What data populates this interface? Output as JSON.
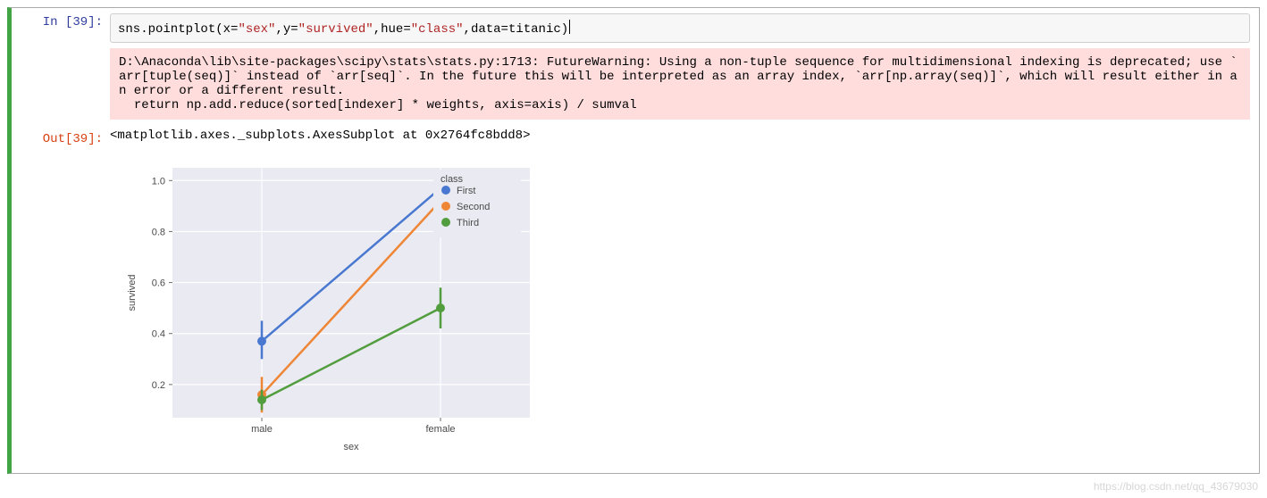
{
  "cell": {
    "in_prompt": "In [39]:",
    "out_prompt": "Out[39]:",
    "code_tokens": {
      "fn": "sns.pointplot",
      "arg1k": "x",
      "arg1v": "\"sex\"",
      "arg2k": "y",
      "arg2v": "\"survived\"",
      "arg3k": "hue",
      "arg3v": "\"class\"",
      "arg4k": "data",
      "arg4v": "titanic"
    },
    "stderr": "D:\\Anaconda\\lib\\site-packages\\scipy\\stats\\stats.py:1713: FutureWarning: Using a non-tuple sequence for multidimensional indexing is deprecated; use `arr[tuple(seq)]` instead of `arr[seq]`. In the future this will be interpreted as an array index, `arr[np.array(seq)]`, which will result either in an error or a different result.\n  return np.add.reduce(sorted[indexer] * weights, axis=axis) / sumval",
    "output_text": "<matplotlib.axes._subplots.AxesSubplot at 0x2764fc8bdd8>"
  },
  "watermark": "https://blog.csdn.net/qq_43679030",
  "chart_data": {
    "type": "pointplot",
    "xlabel": "sex",
    "ylabel": "survived",
    "categories": [
      "male",
      "female"
    ],
    "series": [
      {
        "name": "First",
        "color": "#4878cf",
        "values": [
          0.37,
          0.97
        ],
        "ci": [
          [
            0.3,
            0.45
          ],
          [
            0.93,
            1.0
          ]
        ]
      },
      {
        "name": "Second",
        "color": "#ee8636",
        "values": [
          0.16,
          0.92
        ],
        "ci": [
          [
            0.09,
            0.23
          ],
          [
            0.85,
            0.99
          ]
        ]
      },
      {
        "name": "Third",
        "color": "#529d3e",
        "values": [
          0.14,
          0.5
        ],
        "ci": [
          [
            0.1,
            0.18
          ],
          [
            0.42,
            0.58
          ]
        ]
      }
    ],
    "yticks": [
      0.2,
      0.4,
      0.6,
      0.8,
      1.0
    ],
    "ylim": [
      0.07,
      1.05
    ],
    "legend_title": "class",
    "legend_pos": "upper right"
  }
}
